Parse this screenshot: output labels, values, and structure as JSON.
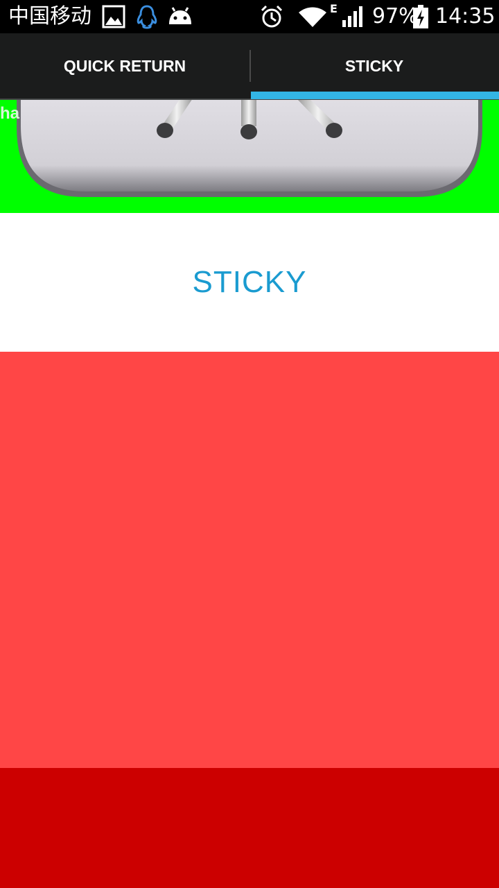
{
  "status_bar": {
    "carrier": "中国移动",
    "network_type": "E",
    "battery": "97%",
    "time": "14:35",
    "icons": [
      "image-icon",
      "qq-icon",
      "android-icon",
      "alarm-icon",
      "wifi-icon",
      "signal-icon",
      "battery-charging-icon"
    ]
  },
  "tabs": [
    {
      "label": "QUICK RETURN",
      "selected": false
    },
    {
      "label": "STICKY",
      "selected": true
    }
  ],
  "header": {
    "partial_text": "ha"
  },
  "sticky": {
    "label": "STICKY"
  },
  "colors": {
    "status_bar_bg": "#000000",
    "tab_bar_bg": "#1b1c1c",
    "tab_indicator": "#33b5e5",
    "header_bg": "#00ff00",
    "sticky_text": "#1a9bd0",
    "red_block": "#ff4646",
    "darkred_block": "#cc0000"
  }
}
